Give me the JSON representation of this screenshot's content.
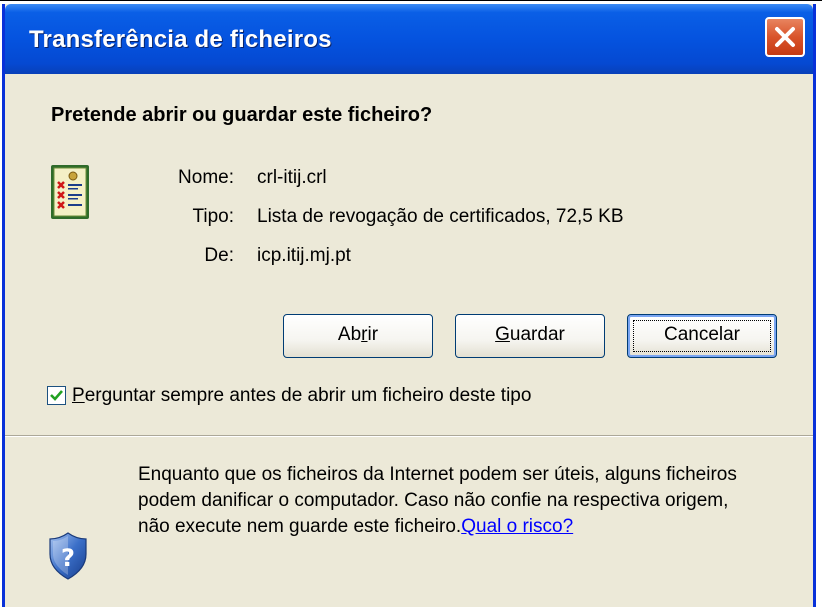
{
  "window": {
    "title": "Transferência de ficheiros"
  },
  "dialog": {
    "question": "Pretende abrir ou guardar este ficheiro?",
    "fields": [
      {
        "label": "Nome:",
        "value": "crl-itij.crl"
      },
      {
        "label": "Tipo:",
        "value": "Lista de revogação de certificados, 72,5 KB"
      },
      {
        "label": "De:",
        "value": "icp.itij.mj.pt"
      }
    ],
    "buttons": {
      "open_pre": "Ab",
      "open_key": "r",
      "open_post": "ir",
      "save_key": "G",
      "save_post": "uardar",
      "cancel": "Cancelar"
    },
    "checkbox": {
      "checked": true,
      "label_key": "P",
      "label_rest": "erguntar sempre antes de abrir um ficheiro deste tipo"
    },
    "warning": {
      "text": "Enquanto que os ficheiros da Internet podem ser úteis, alguns ficheiros podem danificar o computador. Caso não confie na respectiva origem, não execute nem guarde este ficheiro.",
      "link": "Qual o risco?"
    }
  },
  "colors": {
    "titlebar": "#0553df",
    "dialog_bg": "#ece9d8",
    "close_button": "#d9542b",
    "link": "#0000ff"
  },
  "icons": {
    "close": "close-x-icon",
    "file": "certificate-list-icon",
    "shield": "security-shield-question-icon",
    "check": "checkmark-icon"
  }
}
